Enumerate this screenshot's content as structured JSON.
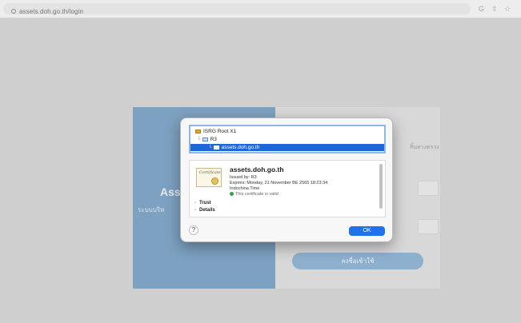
{
  "browser": {
    "url": "assets.doh.go.th/login",
    "toolbar_icons": [
      "G",
      "⇧",
      "☆"
    ]
  },
  "login_page": {
    "brand_title": "Asse",
    "brand_subtitle": "ระบบบริห",
    "right_hint": "สิ้นทางตรวง",
    "login_button": "ลงชื่อเข้าใช้"
  },
  "certificate_dialog": {
    "tree": [
      {
        "label": "ISRG Root X1",
        "level": 0
      },
      {
        "label": "R3",
        "level": 1
      },
      {
        "label": "assets.doh.go.th",
        "level": 2,
        "selected": true
      }
    ],
    "certificate": {
      "icon_text": "Certificate",
      "name": "assets.doh.go.th",
      "issued_by": "Issued by: R3",
      "expires": "Expires: Monday, 21 November BE 2565 18:23:34",
      "timezone": "Indochina Time",
      "validity": "This certificate is valid"
    },
    "sections": [
      "Trust",
      "Details"
    ],
    "help_label": "?",
    "ok_label": "OK"
  }
}
